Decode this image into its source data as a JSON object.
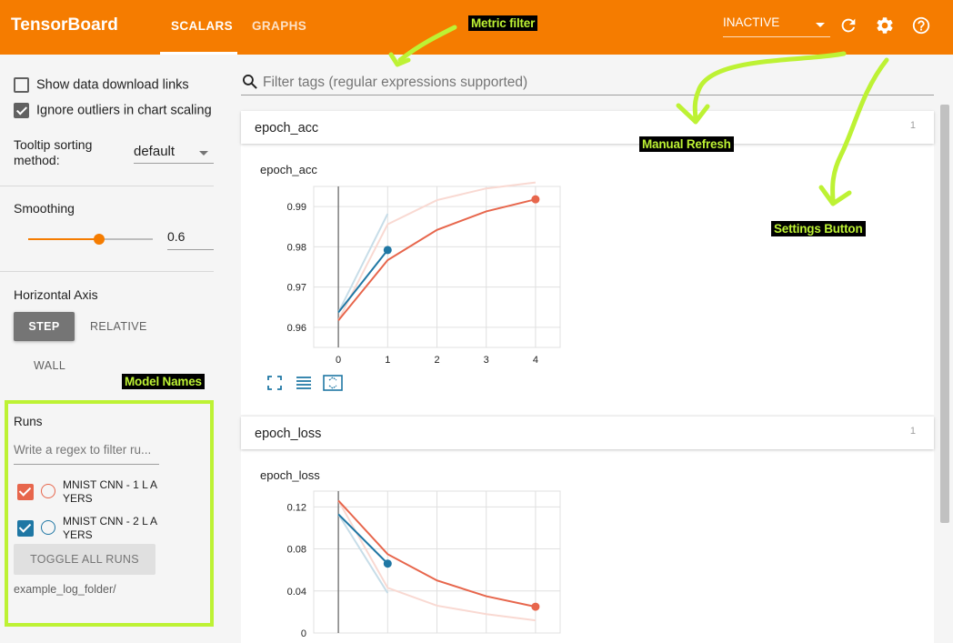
{
  "app": {
    "brand": "TensorBoard"
  },
  "tabs": [
    {
      "label": "SCALARS",
      "active": true
    },
    {
      "label": "GRAPHS",
      "active": false
    }
  ],
  "status_select": {
    "value": "INACTIVE"
  },
  "top_icons": [
    "refresh-icon",
    "settings-icon",
    "help-icon"
  ],
  "sidebar": {
    "show_download_links": {
      "label": "Show data download links",
      "checked": false
    },
    "ignore_outliers": {
      "label": "Ignore outliers in chart scaling",
      "checked": true
    },
    "tooltip_sort": {
      "label_line1": "Tooltip sorting",
      "label_line2": "method:",
      "value": "default"
    },
    "smoothing": {
      "label": "Smoothing",
      "value": "0.6",
      "fraction": 0.6
    },
    "horizontal_axis": {
      "label": "Horizontal Axis",
      "options": [
        "STEP",
        "RELATIVE",
        "WALL"
      ],
      "selected": "STEP"
    }
  },
  "runs": {
    "title": "Runs",
    "filter_placeholder": "Write a regex to filter ru...",
    "items": [
      {
        "label": "MNIST CNN - 1 L AYERS",
        "checked": true,
        "color": "#e7664c"
      },
      {
        "label": "MNIST CNN - 2 L AYERS",
        "checked": true,
        "color": "#1f77a4"
      }
    ],
    "toggle_label": "TOGGLE ALL RUNS",
    "log_folder": "example_log_folder/"
  },
  "search": {
    "placeholder": "Filter tags (regular expressions supported)"
  },
  "cards": [
    {
      "title": "epoch_acc",
      "count": "1",
      "chart_title": "epoch_acc"
    },
    {
      "title": "epoch_loss",
      "count": "1",
      "chart_title": "epoch_loss"
    }
  ],
  "annotations": {
    "metric_filter": "Metric filter",
    "manual_refresh": "Manual Refresh",
    "settings_button": "Settings Button",
    "model_names": "Model Names"
  },
  "colors": {
    "accent": "#f57c00",
    "run1": "#e7664c",
    "run2": "#1f77a4",
    "annotation": "#bdf234"
  },
  "chart_data": [
    {
      "type": "line",
      "title": "epoch_acc",
      "x_ticks": [
        0,
        1,
        2,
        3,
        4
      ],
      "y_ticks": [
        0.96,
        0.97,
        0.98,
        0.99
      ],
      "xlim": [
        -0.5,
        4.5
      ],
      "ylim": [
        0.955,
        0.995
      ],
      "series": [
        {
          "name": "MNIST CNN - 1 L AYERS",
          "color": "#e7664c",
          "x": [
            0,
            1,
            2,
            3,
            4
          ],
          "y": [
            0.9617,
            0.9767,
            0.9842,
            0.9888,
            0.9918
          ],
          "raw_y": [
            0.9617,
            0.9856,
            0.9916,
            0.9945,
            0.996
          ]
        },
        {
          "name": "MNIST CNN - 2 L AYERS",
          "color": "#1f77a4",
          "x": [
            0,
            1
          ],
          "y": [
            0.9637,
            0.9792
          ],
          "raw_y": [
            0.9637,
            0.9882
          ]
        }
      ]
    },
    {
      "type": "line",
      "title": "epoch_loss",
      "x_ticks": [
        0,
        1,
        2,
        3,
        4
      ],
      "y_ticks": [
        0,
        0.04,
        0.08,
        0.12
      ],
      "xlim": [
        -0.5,
        4.5
      ],
      "ylim": [
        0,
        0.135
      ],
      "series": [
        {
          "name": "MNIST CNN - 1 L AYERS",
          "color": "#e7664c",
          "x": [
            0,
            1,
            2,
            3,
            4
          ],
          "y": [
            0.126,
            0.075,
            0.05,
            0.035,
            0.025
          ],
          "raw_y": [
            0.126,
            0.043,
            0.026,
            0.018,
            0.012
          ]
        },
        {
          "name": "MNIST CNN - 2 L AYERS",
          "color": "#1f77a4",
          "x": [
            0,
            1
          ],
          "y": [
            0.113,
            0.066
          ],
          "raw_y": [
            0.113,
            0.038
          ]
        }
      ]
    }
  ]
}
